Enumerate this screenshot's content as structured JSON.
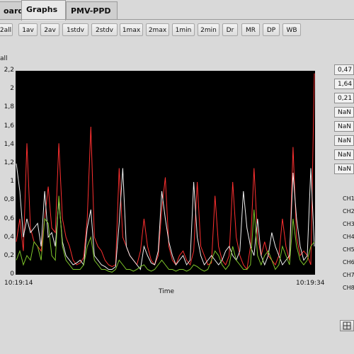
{
  "tabs": [
    {
      "label": "oard"
    },
    {
      "label": "Graphs"
    },
    {
      "label": "PMV-PPD"
    }
  ],
  "toolbar": [
    "2all",
    "1av",
    "2av",
    "1stdv",
    "2stdv",
    "1max",
    "2max",
    "1min",
    "2min",
    "Dr",
    "MR",
    "DP",
    "WB"
  ],
  "graph": {
    "ylabel_fragment": "all",
    "yticks": [
      "2,2",
      "2",
      "1,8",
      "1,6",
      "1,4",
      "1,2",
      "1",
      "0,8",
      "0,6",
      "0,4",
      "0,2",
      "0"
    ],
    "xstart": "10:19:14",
    "xend": "10:19:34",
    "xlabel": "Time"
  },
  "values": [
    "0,47",
    "1,64",
    "0,21",
    "NaN",
    "NaN",
    "NaN",
    "NaN",
    "NaN"
  ],
  "channels": [
    "CH1",
    "CH2",
    "CH3",
    "CH4",
    "CH5",
    "CH6",
    "CH7",
    "CH8"
  ],
  "colors": {
    "red": "#ff3030",
    "white": "#f0f0f0",
    "green": "#7fc72a",
    "plot_bg": "#000000"
  },
  "chart_data": {
    "type": "line",
    "xlabel": "Time",
    "x_start": "10:19:14",
    "x_end": "10:19:34",
    "ylim": [
      0,
      2.2
    ],
    "series": [
      {
        "color": "#ff3030",
        "values": [
          0.35,
          0.6,
          0.25,
          1.42,
          0.5,
          0.35,
          0.3,
          0.25,
          0.6,
          0.95,
          0.5,
          0.45,
          1.42,
          0.6,
          0.4,
          0.3,
          0.15,
          0.1,
          0.12,
          0.18,
          0.6,
          1.6,
          0.4,
          0.3,
          0.25,
          0.15,
          0.1,
          0.08,
          0.1,
          1.15,
          0.4,
          0.3,
          0.2,
          0.15,
          0.1,
          0.25,
          0.6,
          0.3,
          0.15,
          0.1,
          0.2,
          0.7,
          1.05,
          0.3,
          0.15,
          0.1,
          0.2,
          0.25,
          0.15,
          0.1,
          0.25,
          1.0,
          0.3,
          0.2,
          0.1,
          0.12,
          0.85,
          0.3,
          0.15,
          0.1,
          0.2,
          1.0,
          0.4,
          0.2,
          0.1,
          0.05,
          0.3,
          1.15,
          0.4,
          0.2,
          0.35,
          0.2,
          0.15,
          0.1,
          0.2,
          0.6,
          0.3,
          0.15,
          1.38,
          0.4,
          0.2,
          0.25,
          0.2,
          0.1,
          2.18
        ]
      },
      {
        "color": "#f0f0f0",
        "values": [
          1.2,
          0.9,
          0.4,
          0.6,
          0.45,
          0.5,
          0.55,
          0.3,
          0.9,
          0.4,
          0.45,
          0.3,
          0.8,
          0.35,
          0.2,
          0.15,
          0.1,
          0.12,
          0.15,
          0.1,
          0.5,
          0.7,
          0.2,
          0.15,
          0.1,
          0.08,
          0.05,
          0.05,
          0.08,
          0.55,
          1.15,
          0.3,
          0.2,
          0.15,
          0.1,
          0.05,
          0.3,
          0.2,
          0.12,
          0.1,
          0.25,
          0.9,
          0.6,
          0.35,
          0.2,
          0.1,
          0.15,
          0.2,
          0.1,
          0.15,
          1.0,
          0.4,
          0.2,
          0.1,
          0.15,
          0.2,
          0.15,
          0.1,
          0.15,
          0.25,
          0.3,
          0.2,
          0.15,
          0.25,
          0.9,
          0.5,
          0.3,
          0.2,
          0.6,
          0.2,
          0.1,
          0.2,
          0.45,
          0.3,
          0.2,
          0.1,
          0.15,
          0.2,
          1.1,
          0.6,
          0.3,
          0.15,
          0.2,
          1.15,
          0.3
        ]
      },
      {
        "color": "#7fc72a",
        "values": [
          0.15,
          0.25,
          0.1,
          0.2,
          0.15,
          0.35,
          0.3,
          0.15,
          0.6,
          0.55,
          0.2,
          0.15,
          0.85,
          0.3,
          0.15,
          0.1,
          0.05,
          0.05,
          0.05,
          0.1,
          0.3,
          0.4,
          0.15,
          0.1,
          0.05,
          0.05,
          0.03,
          0.02,
          0.05,
          0.15,
          0.1,
          0.05,
          0.05,
          0.03,
          0.05,
          0.08,
          0.1,
          0.05,
          0.03,
          0.05,
          0.1,
          0.15,
          0.1,
          0.05,
          0.05,
          0.03,
          0.05,
          0.05,
          0.03,
          0.05,
          0.1,
          0.08,
          0.05,
          0.03,
          0.05,
          0.15,
          0.25,
          0.2,
          0.1,
          0.05,
          0.1,
          0.3,
          0.15,
          0.1,
          0.05,
          0.05,
          0.1,
          0.7,
          0.2,
          0.1,
          0.2,
          0.25,
          0.15,
          0.05,
          0.1,
          0.3,
          0.2,
          0.1,
          0.6,
          0.3,
          0.15,
          0.1,
          0.15,
          0.3,
          0.35
        ]
      }
    ]
  }
}
